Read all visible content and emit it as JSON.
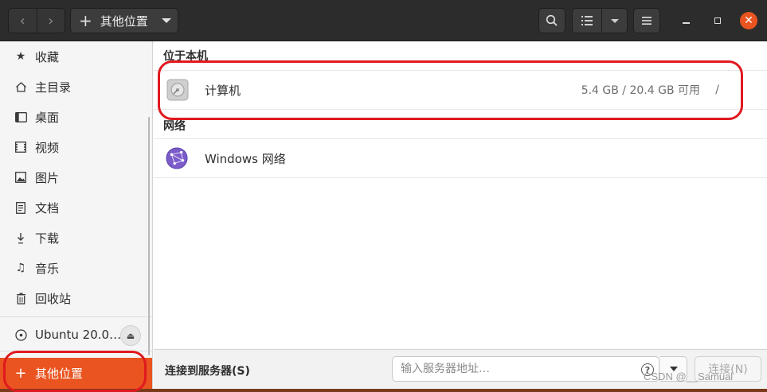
{
  "header": {
    "path_label": "其他位置"
  },
  "sidebar": {
    "items": [
      {
        "label": "收藏",
        "icon": "star-icon"
      },
      {
        "label": "主目录",
        "icon": "home-icon"
      },
      {
        "label": "桌面",
        "icon": "desktop-icon"
      },
      {
        "label": "视频",
        "icon": "video-icon"
      },
      {
        "label": "图片",
        "icon": "picture-icon"
      },
      {
        "label": "文档",
        "icon": "document-icon"
      },
      {
        "label": "下载",
        "icon": "download-icon"
      },
      {
        "label": "音乐",
        "icon": "music-icon"
      },
      {
        "label": "回收站",
        "icon": "trash-icon"
      }
    ],
    "device_label": "Ubuntu 20.0…",
    "other_locations_label": "其他位置"
  },
  "main": {
    "local_section_title": "位于本机",
    "computer": {
      "name": "计算机",
      "usage": "5.4 GB / 20.4 GB 可用",
      "path": "/"
    },
    "network_section_title": "网络",
    "network": {
      "name": "Windows 网络"
    }
  },
  "bottom": {
    "connect_label": "连接到服务器(S)",
    "address_placeholder": "输入服务器地址…",
    "connect_button": "连接(N)"
  },
  "watermark": "CSDN @__Samual",
  "colors": {
    "accent": "#e95420",
    "annotation": "#e0191f"
  }
}
